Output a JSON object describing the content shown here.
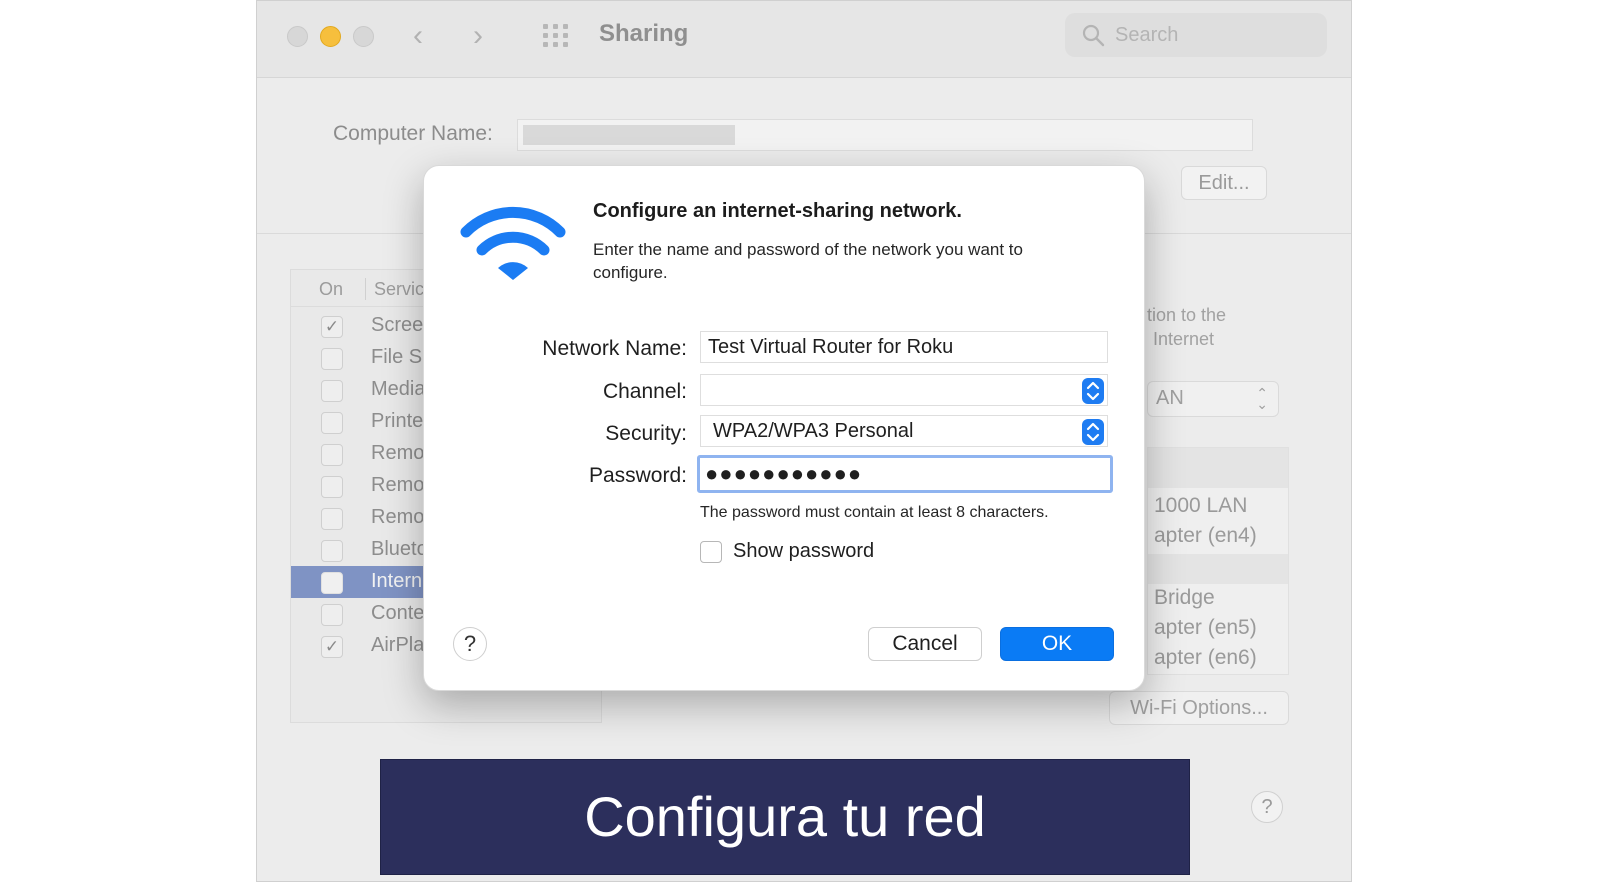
{
  "window": {
    "title": "Sharing",
    "search_placeholder": "Search",
    "computer_name_label": "Computer Name:",
    "edit_label": "Edit..."
  },
  "services": {
    "header_on": "On",
    "header_service": "Servic",
    "items": [
      {
        "name": "Screer",
        "checked": true
      },
      {
        "name": "File Sh",
        "checked": false
      },
      {
        "name": "Media",
        "checked": false
      },
      {
        "name": "Printer",
        "checked": false
      },
      {
        "name": "Remot",
        "checked": false
      },
      {
        "name": "Remot",
        "checked": false
      },
      {
        "name": "Remot",
        "checked": false
      },
      {
        "name": "Blueto",
        "checked": false
      },
      {
        "name": "Interne",
        "checked": false,
        "selected": true
      },
      {
        "name": "Conter",
        "checked": false
      },
      {
        "name": "AirPlay",
        "checked": true
      }
    ],
    "check_glyph": "✓"
  },
  "right_panel": {
    "desc_line1": "tion to the",
    "desc_line2": "Internet",
    "select_value": "AN",
    "list_items": [
      "1000 LAN",
      "apter (en4)",
      "Bridge",
      "apter (en5)",
      "apter (en6)"
    ],
    "wifi_options_label": "Wi-Fi Options...",
    "help_label": "?"
  },
  "dialog": {
    "title": "Configure an internet-sharing network.",
    "description": "Enter the name and password of the network you want to configure.",
    "network_name_label": "Network Name:",
    "network_name_value": "Test Virtual Router for Roku",
    "channel_label": "Channel:",
    "channel_value": "",
    "security_label": "Security:",
    "security_value": "WPA2/WPA3 Personal",
    "password_label": "Password:",
    "password_value": "●●●●●●●●●●●",
    "password_hint": "The password must contain at least 8 characters.",
    "show_password_label": "Show password",
    "help_label": "?",
    "cancel_label": "Cancel",
    "ok_label": "OK",
    "accent_color": "#0a7bf5"
  },
  "banner": {
    "text": "Configura tu red"
  }
}
